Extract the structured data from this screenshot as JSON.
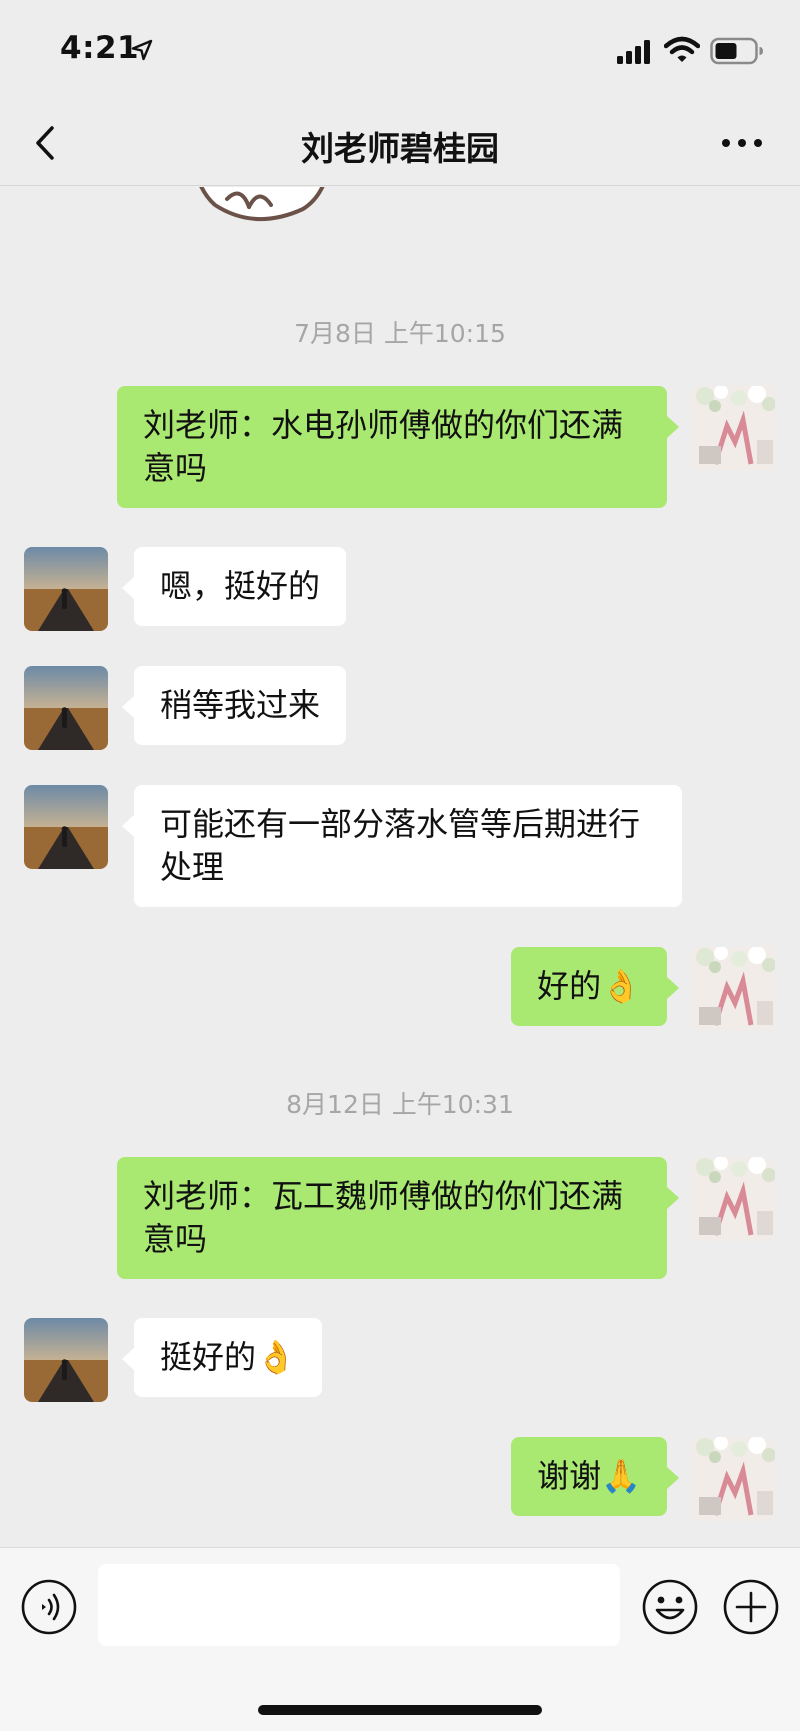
{
  "status_bar": {
    "time": "4:21",
    "icons": [
      "location-arrow-icon",
      "signal-icon",
      "wifi-icon",
      "battery-icon"
    ]
  },
  "nav": {
    "back_icon": "chevron-left-icon",
    "title": "刘老师碧桂园",
    "more_icon": "more-dots-icon"
  },
  "chat": {
    "timestamps": [
      "7月8日 上午10:15",
      "8月12日 上午10:31"
    ],
    "messages": [
      {
        "side": "out",
        "text": "刘老师：水电孙师傅做的你们还满意吗"
      },
      {
        "side": "in",
        "text": "嗯，挺好的"
      },
      {
        "side": "in",
        "text": "稍等我过来"
      },
      {
        "side": "in",
        "text": "可能还有一部分落水管等后期进行处理"
      },
      {
        "side": "out",
        "text": "好的👌"
      },
      {
        "side": "out",
        "text": "刘老师：瓦工魏师傅做的你们还满意吗"
      },
      {
        "side": "in",
        "text": "挺好的👌"
      },
      {
        "side": "out",
        "text": "谢谢🙏"
      }
    ]
  },
  "input_bar": {
    "message_value": "",
    "icons": [
      "voice-icon",
      "emoji-icon",
      "plus-icon"
    ]
  },
  "colors": {
    "background": "#ededed",
    "outgoing_bubble": "#a9e871",
    "incoming_bubble": "#ffffff",
    "timestamp_text": "#a6a6a6"
  }
}
